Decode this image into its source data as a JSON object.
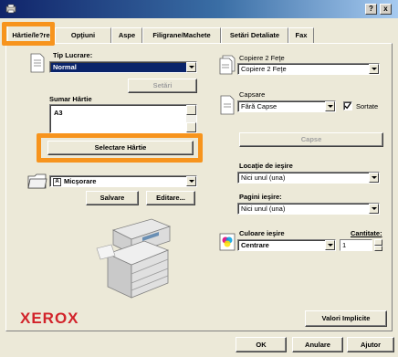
{
  "window": {
    "help_button": "?",
    "close_button": "x"
  },
  "tabs": [
    {
      "label": "Hârtie/le?re",
      "active": true
    },
    {
      "label": "Opţiuni",
      "active": false
    },
    {
      "label": "Aspe",
      "active": false
    },
    {
      "label": "Filigrane/Machete",
      "active": false
    },
    {
      "label": "Setări Detaliate",
      "active": false
    },
    {
      "label": "Fax",
      "active": false
    }
  ],
  "left": {
    "job_type_label": "Tip Lucrare:",
    "job_type_value": "Normal",
    "settings_button": "Setări",
    "paper_summary_label": "Sumar Hârtie",
    "paper_summary_value": "A3",
    "select_paper_button": "Selectare Hârtie",
    "reduce_value": "Micşorare",
    "reduce_prefix": "A",
    "save_button": "Salvare",
    "edit_button": "Editare..."
  },
  "right": {
    "two_sided_label": "Copiere 2 Feţe",
    "two_sided_value": "Copiere 2 Feţe",
    "stapling_label": "Capsare",
    "stapling_value": "Fără Capse",
    "collated_label": "Sortate",
    "collated_checked": true,
    "staple_button": "Capse",
    "output_location_label": "Locaţie de ieşire",
    "output_location_value": "Nici unul (una)",
    "output_pages_label": "Pagini ieşire:",
    "output_pages_value": "Nici unul (una)",
    "output_color_label": "Culoare ieşire",
    "output_color_value": "Centrare",
    "quantity_label": "Cantitate:",
    "quantity_value": "1",
    "defaults_button": "Valori Implicite"
  },
  "footer": {
    "ok_button": "OK",
    "cancel_button": "Anulare",
    "help_button": "Ajutor"
  },
  "brand": {
    "logo_text": "XEROX",
    "logo_color": "#d2232a",
    "highlight_color": "#f7941d",
    "selection_color": "#0a246a"
  }
}
